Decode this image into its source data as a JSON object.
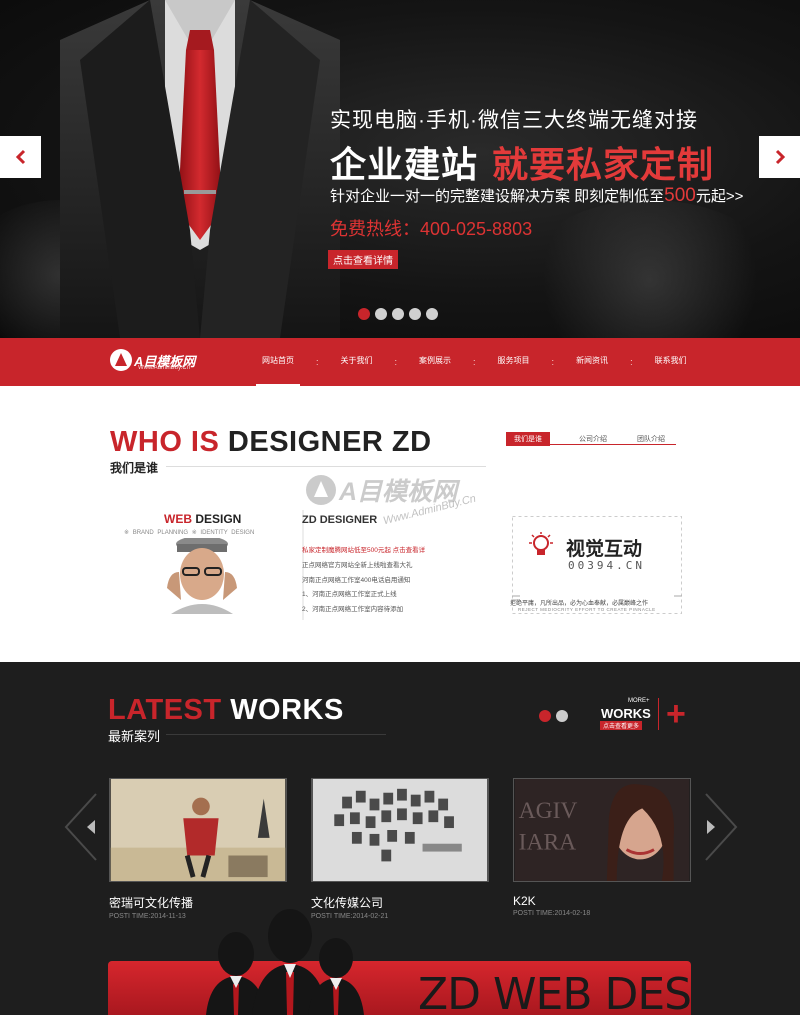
{
  "hero": {
    "headline": "实现电脑·手机·微信三大终端无缝对接",
    "tagline_white": "企业建站",
    "tagline_red": "就要私家定制",
    "offer_prefix": "针对企业一对一的完整建设解决方案   即刻定制低至",
    "offer_price": "500",
    "offer_suffix": "元起>>",
    "hotline": "免费热线：400-025-8803",
    "detail_button": "点击查看详情",
    "slide_count": 5,
    "active_slide": 1,
    "prev_icon": "chevron-left-icon",
    "next_icon": "chevron-right-icon"
  },
  "nav": {
    "logo_text": "A目模板网",
    "logo_sub": "Www.AdminBuy.Cn",
    "items": [
      "网站首页",
      "关于我们",
      "案例展示",
      "服务项目",
      "新闻资讯",
      "联系我们"
    ],
    "active": 0
  },
  "about": {
    "title_red": "WHO IS",
    "title_dark": "DESIGNER ZD",
    "subtitle": "我们是谁",
    "tabs": [
      "我们是谁",
      "公司介绍",
      "团队介绍"
    ],
    "active_tab": 0,
    "watermark": "A目模板网",
    "watermark_url": "Www.AdminBuy.Cn",
    "web_design_red": "WEB",
    "web_design_dark": "DESIGN",
    "web_design_tags": "※ BRAND PLANNING   ※ IDENTITY DESIGN",
    "zd_title": "ZD DESIGNER",
    "zd_lines": [
      "私家定制魔腾网站低至500元起 点击查看详",
      "正点网络官方网站全新上线啦查看大礼",
      "河南正点网络工作室400电话启用通知",
      "1、河南正点网络工作室正式上线",
      "2、河南正点网络工作室内容待添加"
    ],
    "brand_name": "视觉互动",
    "brand_number": "00394.CN",
    "brand_slogan": "拒绝平庸，凡所出品，必为心血奉献，必属巅峰之作",
    "brand_slogan_en": "REJECT MEDIOCRITY EFFORT TO CREATE PINNACLE"
  },
  "works": {
    "title_red": "LATEST",
    "title_dark": "WORKS",
    "subtitle": "最新案列",
    "page_dots": 2,
    "active_dot": 0,
    "more_label": "MORE+",
    "more_works": "WORKS",
    "more_tag": "点击查看更多",
    "cases": [
      {
        "name": "密瑞可文化传播",
        "time": "POSTI TIME:2014-11-13"
      },
      {
        "name": "文化传媒公司",
        "time": "POSTI TIME:2014-02-21"
      },
      {
        "name": "K2K",
        "time": "POSTI TIME:2014-02-18"
      }
    ],
    "banner_text": "ZD WEB DESIGN"
  },
  "colors": {
    "brand_red": "#c8252b",
    "dark_bg": "#1e1e1e",
    "hero_bg": "#0d0d0d"
  }
}
